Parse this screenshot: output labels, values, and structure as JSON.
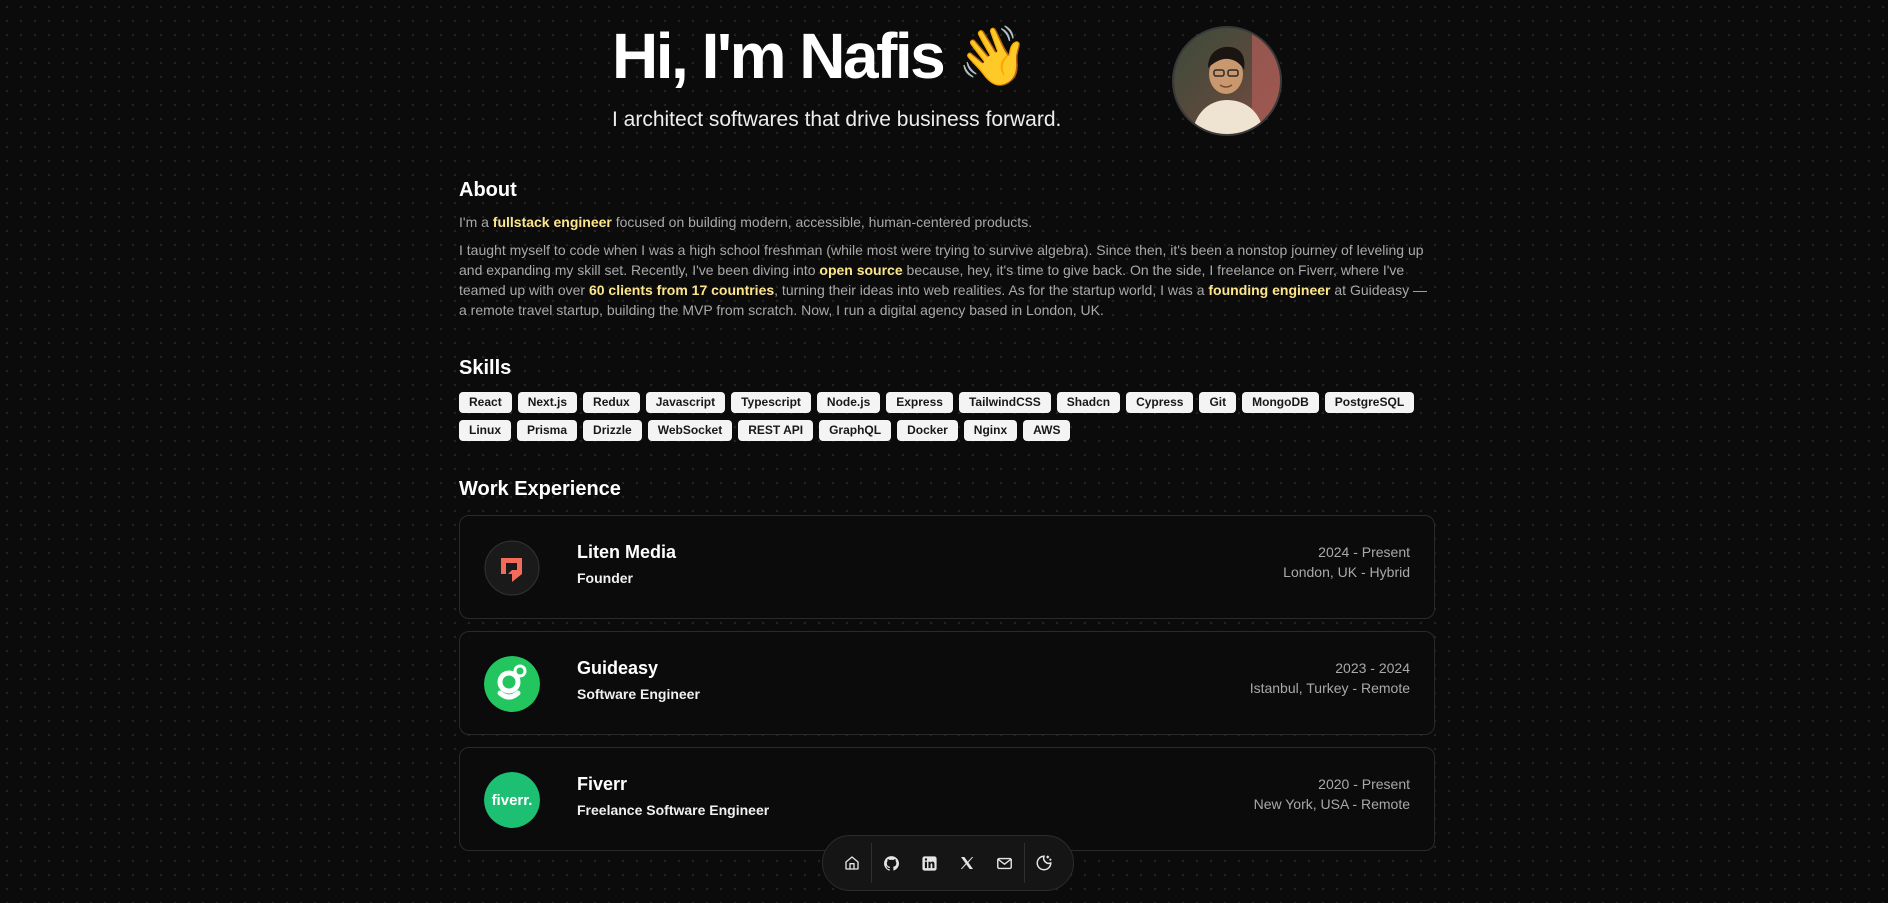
{
  "hero": {
    "title": "Hi, I'm Nafis",
    "wave_emoji": "👋",
    "subtitle": "I architect softwares that drive business forward.",
    "avatar_icon": "avatar"
  },
  "about": {
    "title": "About",
    "p1": {
      "t1": "I'm a ",
      "h1": "fullstack engineer",
      "t2": " focused on building modern, accessible, human-centered products."
    },
    "p2": {
      "t1": "I taught myself to code when I was a high school freshman (while most were trying to survive algebra). Since then, it's been a nonstop journey of leveling up and expanding my skill set. Recently, I've been diving into ",
      "h1": "open source",
      "t2": " because, hey, it's time to give back. On the side, I freelance on Fiverr, where I've teamed up with over ",
      "h2": "60 clients from 17 countries",
      "t3": ", turning their ideas into web realities. As for the startup world, I was a ",
      "h3": "founding engineer",
      "t4": " at Guideasy — a remote travel startup, building the MVP from scratch. Now, I run a digital agency based in London, UK."
    },
    "highlight_color": "#fde68a"
  },
  "skills": {
    "title": "Skills",
    "items": [
      "React",
      "Next.js",
      "Redux",
      "Javascript",
      "Typescript",
      "Node.js",
      "Express",
      "TailwindCSS",
      "Shadcn",
      "Cypress",
      "Git",
      "MongoDB",
      "PostgreSQL",
      "Linux",
      "Prisma",
      "Drizzle",
      "WebSocket",
      "REST API",
      "GraphQL",
      "Docker",
      "Nginx",
      "AWS"
    ]
  },
  "work": {
    "title": "Work Experience",
    "jobs": [
      {
        "company": "Liten Media",
        "role": "Founder",
        "period": "2024 - Present",
        "location": "London, UK - Hybrid",
        "logo_icon": "liten-media-logo",
        "logo_color": "#f26b5b"
      },
      {
        "company": "Guideasy",
        "role": "Software Engineer",
        "period": "2023 - 2024",
        "location": "Istanbul, Turkey - Remote",
        "logo_icon": "guideasy-logo",
        "logo_color": "#22c55e"
      },
      {
        "company": "Fiverr",
        "role": "Freelance Software Engineer",
        "period": "2020 - Present",
        "location": "New York, USA - Remote",
        "logo_icon": "fiverr-logo",
        "logo_color": "#1dbf73",
        "logo_text": "fiverr."
      }
    ]
  },
  "dock": {
    "items": [
      {
        "icon": "home-icon"
      },
      {
        "icon": "github-icon"
      },
      {
        "icon": "linkedin-icon"
      },
      {
        "icon": "x-twitter-icon"
      },
      {
        "icon": "mail-icon"
      },
      {
        "icon": "theme-toggle-icon"
      }
    ]
  }
}
